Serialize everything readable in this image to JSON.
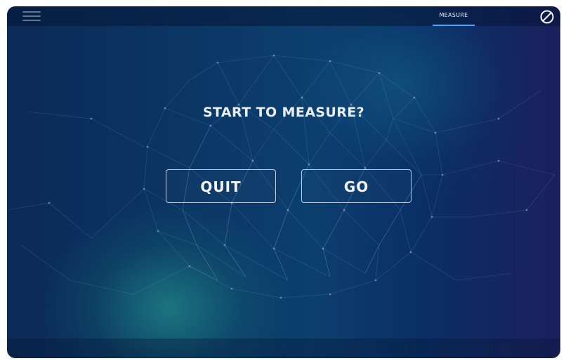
{
  "header": {
    "tabs": [
      {
        "label": "MEASURE",
        "active": true
      }
    ]
  },
  "icons": {
    "menu": "hamburger-menu-icon",
    "close": "prohibited-circle-icon"
  },
  "dialog": {
    "prompt": "START TO MEASURE?",
    "quit_label": "QUIT",
    "go_label": "GO"
  },
  "colors": {
    "accent": "#3fa6ff",
    "background_dark": "#0b2a57",
    "background_teal": "#28aa96",
    "text": "#e9eef6"
  }
}
